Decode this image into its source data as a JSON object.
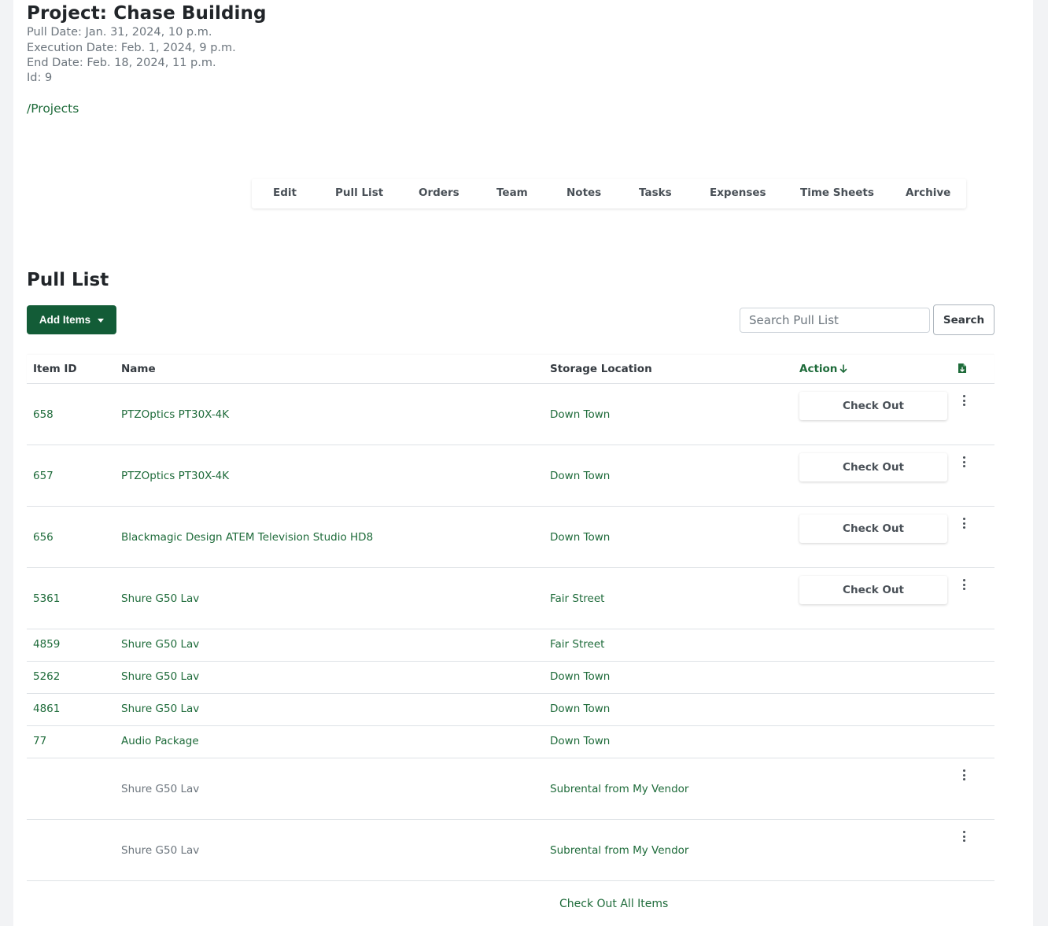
{
  "project": {
    "title": "Project: Chase Building",
    "pull_date": "Pull Date: Jan. 31, 2024, 10 p.m.",
    "execution_date": "Execution Date: Feb. 1, 2024, 9 p.m.",
    "end_date": "End Date: Feb. 18, 2024, 11 p.m.",
    "id": "Id: 9",
    "breadcrumb": "/Projects"
  },
  "tabs": [
    "Edit",
    "Pull List",
    "Orders",
    "Team",
    "Notes",
    "Tasks",
    "Expenses",
    "Time Sheets",
    "Archive"
  ],
  "pull_list": {
    "title": "Pull List",
    "add_items_label": "Add Items",
    "search_placeholder": "Search Pull List",
    "search_label": "Search",
    "columns": {
      "item_id": "Item ID",
      "name": "Name",
      "storage_location": "Storage Location",
      "action": "Action",
      "action_sort_icon": "arrow-down-icon",
      "export_icon": "file-download-icon"
    },
    "rows": [
      {
        "id": "658",
        "name": "PTZOptics PT30X-4K",
        "location": "Down Town",
        "action": "Check Out"
      },
      {
        "id": "657",
        "name": "PTZOptics PT30X-4K",
        "location": "Down Town",
        "action": "Check Out"
      },
      {
        "id": "656",
        "name": "Blackmagic Design ATEM Television Studio HD8",
        "location": "Down Town",
        "action": "Check Out"
      },
      {
        "id": "5361",
        "name": "Shure G50 Lav",
        "location": "Fair Street",
        "action": "Check Out"
      },
      {
        "id": "4859",
        "name": "Shure G50 Lav",
        "location": "Fair Street"
      },
      {
        "id": "5262",
        "name": "Shure G50 Lav",
        "location": "Down Town"
      },
      {
        "id": "4861",
        "name": "Shure G50 Lav",
        "location": "Down Town"
      },
      {
        "id": "77",
        "name": "Audio Package",
        "location": "Down Town"
      },
      {
        "id": "",
        "name": "Shure G50 Lav",
        "location": "Subrental from My Vendor"
      },
      {
        "id": "",
        "name": "Shure G50 Lav",
        "location": "Subrental from My Vendor"
      }
    ],
    "check_out_all_label": "Check Out All Items"
  },
  "colors": {
    "accent": "#1e6b3a",
    "primary_button": "#135c37"
  }
}
